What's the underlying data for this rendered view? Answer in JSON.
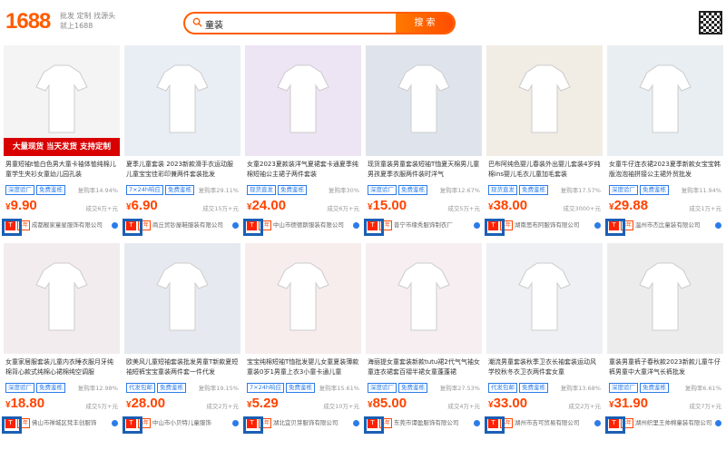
{
  "header": {
    "logo": "1688",
    "slogan": "批发 定制 找源头 就上1688",
    "search_value": "童装",
    "search_button": "搜 索"
  },
  "products": [
    {
      "title": "男童短袖t恤白色男大童卡袖体恤纯棉儿童学生夹衫女童幼儿园孔装",
      "tags": [
        "深度验厂",
        "免费鉴栋"
      ],
      "rate": "复购率14.94%",
      "price": "9.90",
      "sold": "成交6万+元",
      "shop": "成都靓家童星服饰有限公司",
      "years": "5年",
      "banner": "大量现货 当天发货 支持定制",
      "img": "#f4f4f4"
    },
    {
      "title": "夏季儿童套装 2023新款滑手衣运动服儿童宝宝佳彩印兼两件套装批发",
      "tags": [
        "7×24h响应",
        "免费鉴栋"
      ],
      "rate": "复购率29.11%",
      "price": "6.90",
      "sold": "成交15万+元",
      "shop": "商丘贸钞屋鞋服装有限公司",
      "years": "2年",
      "img": "#e9eef5"
    },
    {
      "title": "女童2023夏款装洋气夏裙套卡通夏季纯棉短袖公主裙子两件套装",
      "tags": [
        "现货直发",
        "免费鉴栋"
      ],
      "rate": "复购率30%",
      "price": "24.00",
      "sold": "成交6万+元",
      "shop": "中山市德德斯服装有限公司",
      "years": "1年",
      "img": "#ede4f4"
    },
    {
      "title": "现货童装男童套装短袖T恤夏天棉男儿童男孩夏季衣服两件装时洋气",
      "tags": [
        "深度验厂",
        "免费鉴栋"
      ],
      "rate": "复购率12.67%",
      "price": "15.00",
      "sold": "成交5万+元",
      "shop": "普宁市缘秀服饰制衣厂",
      "years": "1年",
      "img": "#dfe4ec"
    },
    {
      "title": "巴布阿纯色婴儿春装外出婴儿套装4岁纯棉ins婴儿毛衣儿童加毛套装",
      "tags": [
        "现货直发",
        "免费鉴栋"
      ],
      "rate": "复购率17.57%",
      "price": "38.00",
      "sold": "成交3000+元",
      "shop": "湖南思布阿服饰有限公司",
      "years": "4年",
      "img": "#f1ece4"
    },
    {
      "title": "女童牛仔连衣裙2023夏季新款女宝宝韩版泡泡袖拼接公主裙外贸批发",
      "tags": [
        "深度验厂",
        "免费鉴栋"
      ],
      "rate": "复购率11.94%",
      "price": "29.88",
      "sold": "成交1万+元",
      "shop": "温州市杰比童装有限公司",
      "years": "8年",
      "img": "#e8eef2"
    },
    {
      "title": "女童家居服套装儿童内衣睡衣服月牙纯棉背心款式纯棉心裙棉纯空调服",
      "tags": [
        "深度验厂",
        "免费鉴栋"
      ],
      "rate": "复购率12.98%",
      "price": "18.80",
      "sold": "成交5万+元",
      "shop": "佛山市禅城区梵丰创服饰",
      "years": "1年",
      "img": "#f3ecef"
    },
    {
      "title": "欧美风儿童短袖套装批发男童T新款夏短袖短裤宝宝童装两件套一件代发",
      "tags": [
        "代发包邮",
        "免费鉴栋"
      ],
      "rate": "复购率19.15%",
      "price": "28.00",
      "sold": "成交2万+元",
      "shop": "中山市小贝特儿童服饰",
      "years": "8年",
      "img": "#e6eaf0"
    },
    {
      "title": "宝宝纯棉短袖T恤批发婴儿女童夏装薄款童装0岁1男童上衣3小童卡通儿童",
      "tags": [
        "7×24h响应",
        "免费鉴栋"
      ],
      "rate": "复购率15.61%",
      "price": "5.29",
      "sold": "成交10万+元",
      "shop": "湖北宜贝芽服饰有限公司",
      "years": "4年",
      "img": "#f7eded"
    },
    {
      "title": "海丽提女童套装新款tutu裙2代气气袖女童连衣裙套百褶半裙女童蓬蓬裙",
      "tags": [
        "深度验厂",
        "免费鉴栋"
      ],
      "rate": "复购率27.53%",
      "price": "85.00",
      "sold": "成交4万+元",
      "shop": "东莞市谭盈服饰有限公司",
      "years": "5年",
      "img": "#f6eef0"
    },
    {
      "title": "潮流男童套装秋季卫衣长袖套装运动风学校秋冬衣卫衣两件套女童",
      "tags": [
        "代发包邮",
        "免费鉴栋"
      ],
      "rate": "复购率13.68%",
      "price": "33.00",
      "sold": "成交2万+元",
      "shop": "湖州市吉可贸易有限公司",
      "years": "6年",
      "img": "#eef0f3"
    },
    {
      "title": "童装男童裤子春秋款2023新款儿童牛仔裤男童中大童洋气长裤批发",
      "tags": [
        "深度验厂",
        "免费鉴栋"
      ],
      "rate": "复购率6.61%",
      "price": "31.90",
      "sold": "成交7万+元",
      "shop": "湖州织里王帅棉童装有限公司",
      "years": "3年",
      "img": "#ececec"
    }
  ]
}
